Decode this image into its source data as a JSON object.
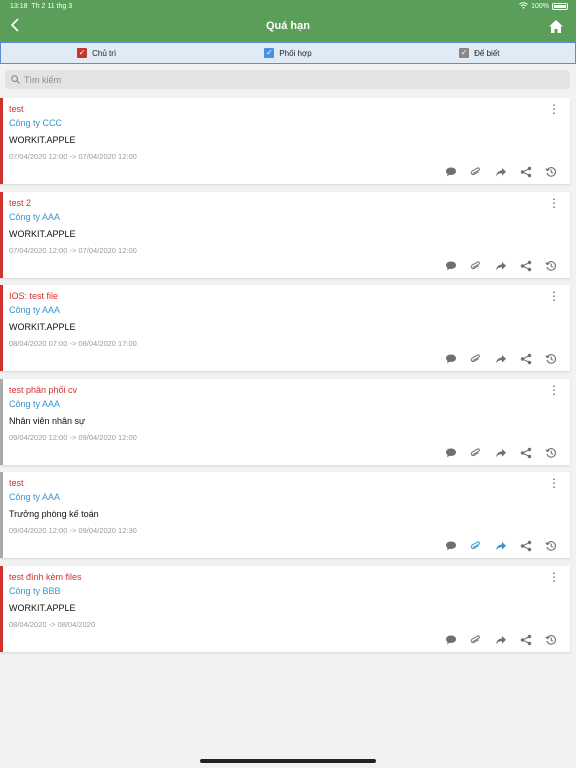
{
  "status": {
    "time": "13:18",
    "date": "Th 2 11 thg 3",
    "battery": "100%"
  },
  "header": {
    "title": "Quá hạn"
  },
  "filters": [
    {
      "label": "Chủ trì",
      "color": "#c0392b"
    },
    {
      "label": "Phối hợp",
      "color": "#4a90e2"
    },
    {
      "label": "Để biết",
      "color": "#888888"
    }
  ],
  "search": {
    "placeholder": "Tìm kiếm"
  },
  "tasks": [
    {
      "name": "test",
      "company": "Công ty CCC",
      "owner": "WORKIT.APPLE",
      "dates": "07/04/2020 12:00 -> 07/04/2020 12:00",
      "border": "red",
      "active": ""
    },
    {
      "name": "test 2",
      "company": "Công ty AAA",
      "owner": "WORKIT.APPLE",
      "dates": "07/04/2020 12:00 -> 07/04/2020 12:00",
      "border": "red",
      "active": ""
    },
    {
      "name": "IOS: test file",
      "company": "Công ty AAA",
      "owner": "WORKIT.APPLE",
      "dates": "08/04/2020 07:00 -> 08/04/2020 17:00",
      "border": "red",
      "active": ""
    },
    {
      "name": "test phân phối cv",
      "company": "Công ty AAA",
      "owner": "Nhân viên nhân sự",
      "dates": "09/04/2020 12:00 -> 09/04/2020 12:00",
      "border": "gray",
      "active": ""
    },
    {
      "name": "test",
      "company": "Công ty AAA",
      "owner": "Trưởng phòng kế toán",
      "dates": "09/04/2020 12:00 -> 09/04/2020 12:30",
      "border": "gray",
      "active": "blue"
    },
    {
      "name": "test đính kèm files",
      "company": "Công ty BBB",
      "owner": "WORKIT.APPLE",
      "dates": "08/04/2020 -> 08/04/2020",
      "border": "red",
      "active": ""
    }
  ]
}
